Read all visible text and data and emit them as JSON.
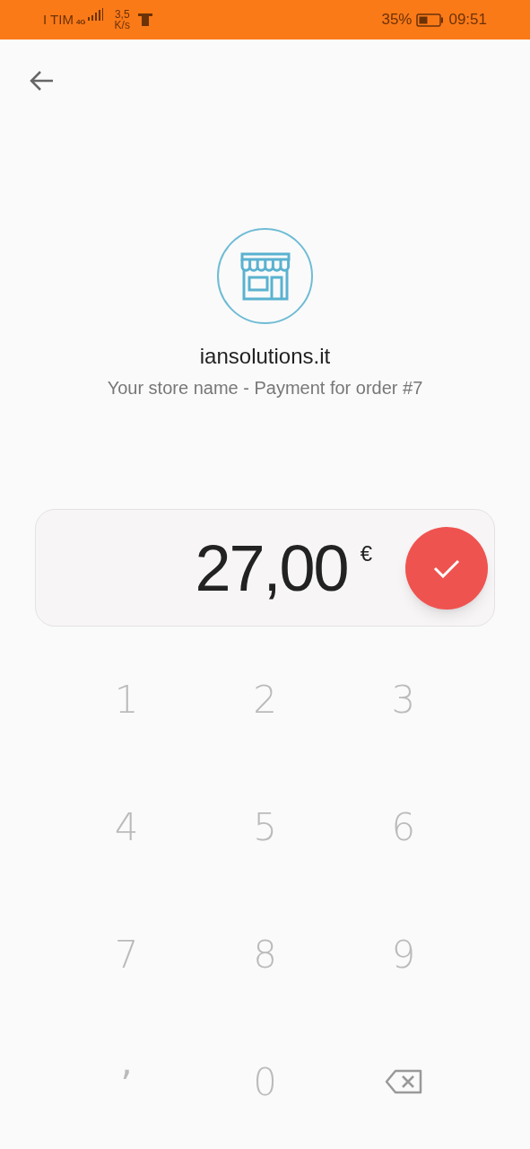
{
  "status_bar": {
    "carrier": "I TIM",
    "network": "4G",
    "speed_value": "3,5",
    "speed_unit": "K/s",
    "battery": "35%",
    "time": "09:51"
  },
  "merchant": {
    "name": "iansolutions.it",
    "description": "Your store name - Payment for order #7"
  },
  "amount": {
    "value": "27,00",
    "currency": "€"
  },
  "keypad": [
    {
      "kind": "digit",
      "label": "1"
    },
    {
      "kind": "digit",
      "label": "2"
    },
    {
      "kind": "digit",
      "label": "3"
    },
    {
      "kind": "digit",
      "label": "4"
    },
    {
      "kind": "digit",
      "label": "5"
    },
    {
      "kind": "digit",
      "label": "6"
    },
    {
      "kind": "digit",
      "label": "7"
    },
    {
      "kind": "digit",
      "label": "8"
    },
    {
      "kind": "digit",
      "label": "9"
    },
    {
      "kind": "separator",
      "label": ","
    },
    {
      "kind": "digit",
      "label": "0"
    },
    {
      "kind": "backspace"
    }
  ]
}
